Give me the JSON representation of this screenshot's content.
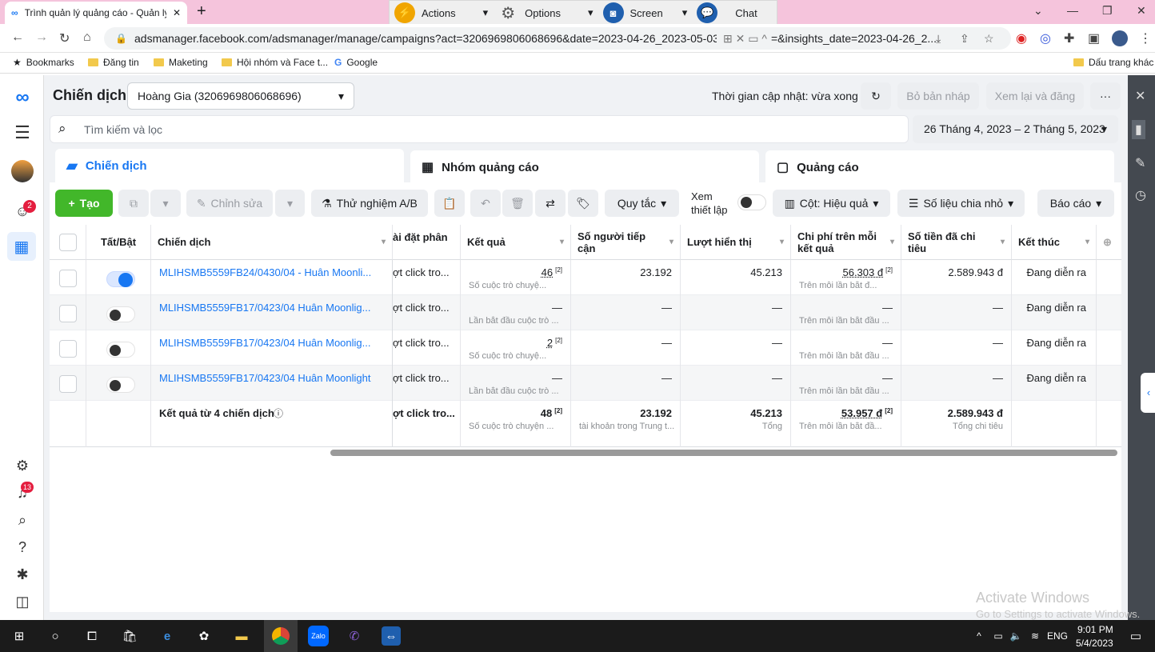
{
  "browser": {
    "tab_title": "Trình quản lý quảng cáo - Quản lý",
    "url": "adsmanager.facebook.com/adsmanager/manage/campaigns?act=3206969806068696&date=2023-04-26_2023-05-03&comp",
    "url_tail": "=&insights_date=2023-04-26_2...",
    "bookmarks": [
      "Bookmarks",
      "Đăng tin",
      "Maketing",
      "Hội nhóm và Face t...",
      "Google"
    ],
    "bookmark_right": "Dấu trang khác"
  },
  "remote_toolbar": {
    "actions": "Actions",
    "options": "Options",
    "screen": "Screen",
    "chat": "Chat"
  },
  "header": {
    "title": "Chiến dịch",
    "account": "Hoàng Gia (3206969806068696)",
    "update_time": "Thời gian cập nhật: vừa xong",
    "discard": "Bỏ bản nháp",
    "review": "Xem lại và đăng",
    "more": "···"
  },
  "search": {
    "placeholder": "Tìm kiếm và lọc",
    "date_range": "26 Tháng 4, 2023 – 2 Tháng 5, 2023"
  },
  "tabs": {
    "campaigns": "Chiến dịch",
    "adsets": "Nhóm quảng cáo",
    "ads": "Quảng cáo"
  },
  "toolbar": {
    "create": "Tạo",
    "edit": "Chỉnh sửa",
    "ab": "Thử nghiệm A/B",
    "rules": "Quy tắc",
    "view_setup_1": "Xem",
    "view_setup_2": "thiết lập",
    "columns": "Cột: Hiệu quả",
    "breakdown": "Số liệu chia nhỏ",
    "reports": "Báo cáo"
  },
  "columns": {
    "toggle": "Tất/Bật",
    "campaign": "Chiến dịch",
    "attribution": "ài đặt phân",
    "results": "Kết quả",
    "reach_1": "Số người tiếp",
    "reach_2": "cận",
    "impressions": "Lượt hiển thị",
    "cpr_1": "Chi phí trên mỗi",
    "cpr_2": "kết quả",
    "spent_1": "Số tiền đã chi",
    "spent_2": "tiêu",
    "ends": "Kết thúc"
  },
  "rows": [
    {
      "name": "MLIHSMB5559FB24/0430/04 - Huân Moonli...",
      "on": true,
      "attr": "ợt click tro...",
      "result": "46",
      "result_sub": "Số cuộc trò chuyệ...",
      "reach": "23.192",
      "impr": "45.213",
      "cpr": "56.303 đ",
      "cpr_sub": "Trên mỗi lần bắt đ...",
      "spent": "2.589.943 đ",
      "ends": "Đang diễn ra"
    },
    {
      "name": "MLIHSMB5559FB17/0423/04 Huân Moonlig...",
      "on": false,
      "attr": "ợt click tro...",
      "result": "—",
      "result_sub": "Lần bắt đầu cuộc trò ...",
      "reach": "—",
      "impr": "—",
      "cpr": "—",
      "cpr_sub": "Trên mỗi lần bắt đầu ...",
      "spent": "—",
      "ends": "Đang diễn ra"
    },
    {
      "name": "MLIHSMB5559FB17/0423/04 Huân Moonlig...",
      "on": false,
      "attr": "ợt click tro...",
      "result": "2",
      "result_sub": "Số cuộc trò chuyệ...",
      "reach": "—",
      "impr": "—",
      "cpr": "—",
      "cpr_sub": "Trên mỗi lần bắt đầu ...",
      "spent": "—",
      "ends": "Đang diễn ra"
    },
    {
      "name": "MLIHSMB5559FB17/0423/04 Huân Moonlight",
      "on": false,
      "attr": "ợt click tro...",
      "result": "—",
      "result_sub": "Lần bắt đầu cuộc trò ...",
      "reach": "—",
      "impr": "—",
      "cpr": "—",
      "cpr_sub": "Trên mỗi lần bắt đầu ...",
      "spent": "—",
      "ends": "Đang diễn ra"
    }
  ],
  "totals": {
    "label": "Kết quả từ 4 chiến dịch",
    "attr": "ợt click tro...",
    "result": "48",
    "result_sub": "Số cuộc trò chuyện ...",
    "reach": "23.192",
    "reach_sub": "tài khoản trong Trung t...",
    "impr": "45.213",
    "impr_sub": "Tổng",
    "cpr": "53.957 đ",
    "cpr_sub": "Trên mỗi lần bắt đầ...",
    "spent": "2.589.943 đ",
    "spent_sub": "Tổng chi tiêu"
  },
  "sup": "[2]",
  "badges": {
    "messages": "2",
    "notifications": "13"
  },
  "watermark": {
    "line1": "Activate Windows",
    "line2": "Go to Settings to activate Windows."
  },
  "taskbar": {
    "lang": "ENG",
    "time": "9:01 PM",
    "date": "5/4/2023",
    "zalo": "Zalo"
  }
}
